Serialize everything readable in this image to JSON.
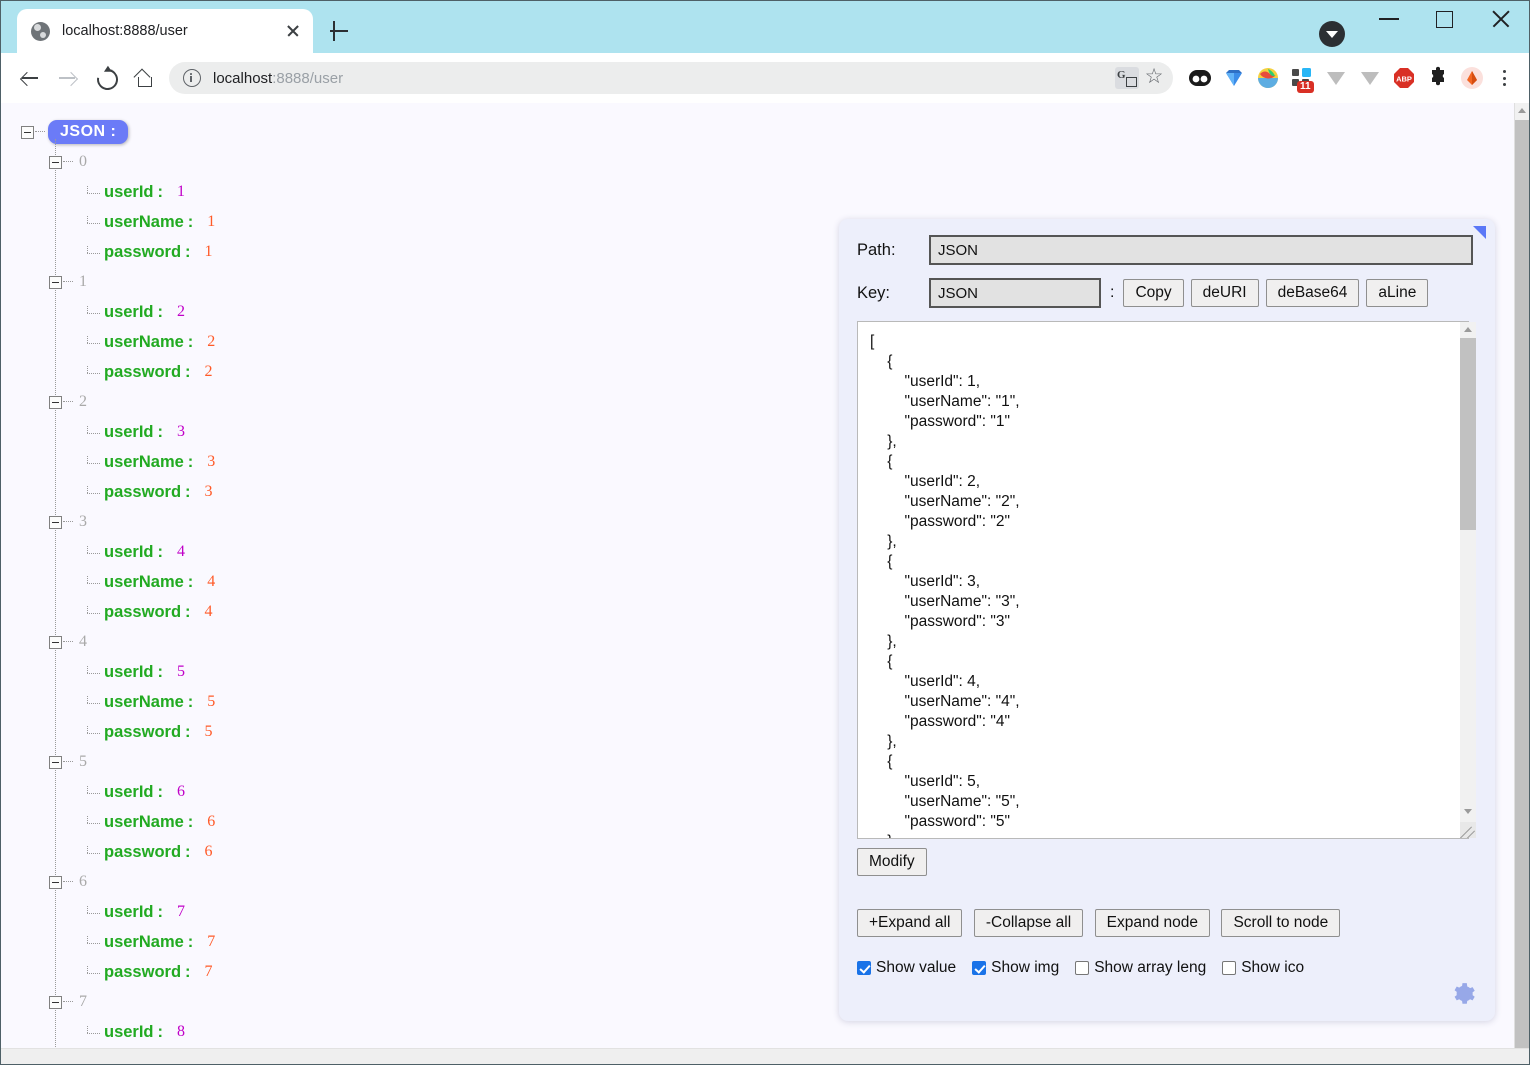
{
  "browser": {
    "tab": {
      "title": "localhost:8888/user",
      "favicon": "globe-icon",
      "close": "close-icon"
    },
    "newtab_label": "+",
    "address": {
      "scheme_host": "localhost",
      "rest": ":8888/user",
      "full": "localhost:8888/user"
    },
    "window_controls": {
      "minimize": "minimize-icon",
      "maximize": "maximize-icon",
      "close": "close-icon"
    },
    "extensions": [
      {
        "name": "ublock-origin-icon"
      },
      {
        "name": "diamond-extension-icon"
      },
      {
        "name": "colorful-bowl-extension-icon"
      },
      {
        "name": "blocks-extension-icon",
        "badge": "11"
      },
      {
        "name": "v-extension-icon"
      },
      {
        "name": "v2-extension-icon"
      },
      {
        "name": "adblock-plus-icon",
        "label": "ABP"
      },
      {
        "name": "puzzle-extensions-icon"
      },
      {
        "name": "profile-avatar-icon"
      }
    ]
  },
  "tree": {
    "root_label": "JSON :",
    "nodes": [
      {
        "index": "0",
        "fields": [
          {
            "key": "userId",
            "value": "1",
            "type": "num"
          },
          {
            "key": "userName",
            "value": "1",
            "type": "str"
          },
          {
            "key": "password",
            "value": "1",
            "type": "str"
          }
        ]
      },
      {
        "index": "1",
        "fields": [
          {
            "key": "userId",
            "value": "2",
            "type": "num"
          },
          {
            "key": "userName",
            "value": "2",
            "type": "str"
          },
          {
            "key": "password",
            "value": "2",
            "type": "str"
          }
        ]
      },
      {
        "index": "2",
        "fields": [
          {
            "key": "userId",
            "value": "3",
            "type": "num"
          },
          {
            "key": "userName",
            "value": "3",
            "type": "str"
          },
          {
            "key": "password",
            "value": "3",
            "type": "str"
          }
        ]
      },
      {
        "index": "3",
        "fields": [
          {
            "key": "userId",
            "value": "4",
            "type": "num"
          },
          {
            "key": "userName",
            "value": "4",
            "type": "str"
          },
          {
            "key": "password",
            "value": "4",
            "type": "str"
          }
        ]
      },
      {
        "index": "4",
        "fields": [
          {
            "key": "userId",
            "value": "5",
            "type": "num"
          },
          {
            "key": "userName",
            "value": "5",
            "type": "str"
          },
          {
            "key": "password",
            "value": "5",
            "type": "str"
          }
        ]
      },
      {
        "index": "5",
        "fields": [
          {
            "key": "userId",
            "value": "6",
            "type": "num"
          },
          {
            "key": "userName",
            "value": "6",
            "type": "str"
          },
          {
            "key": "password",
            "value": "6",
            "type": "str"
          }
        ]
      },
      {
        "index": "6",
        "fields": [
          {
            "key": "userId",
            "value": "7",
            "type": "num"
          },
          {
            "key": "userName",
            "value": "7",
            "type": "str"
          },
          {
            "key": "password",
            "value": "7",
            "type": "str"
          }
        ]
      },
      {
        "index": "7",
        "fields": [
          {
            "key": "userId",
            "value": "8",
            "type": "num"
          }
        ]
      }
    ]
  },
  "panel": {
    "path_label": "Path:",
    "path_value": "JSON",
    "key_label": "Key:",
    "key_value": "JSON",
    "colon": ":",
    "buttons": {
      "copy": "Copy",
      "deuri": "deURI",
      "debase64": "deBase64",
      "aline": "aLine",
      "modify": "Modify",
      "expand_all": "+Expand all",
      "collapse_all": "-Collapse all",
      "expand_node": "Expand node",
      "scroll_to_node": "Scroll to node"
    },
    "json_text": "[\n    {\n        \"userId\": 1,\n        \"userName\": \"1\",\n        \"password\": \"1\"\n    },\n    {\n        \"userId\": 2,\n        \"userName\": \"2\",\n        \"password\": \"2\"\n    },\n    {\n        \"userId\": 3,\n        \"userName\": \"3\",\n        \"password\": \"3\"\n    },\n    {\n        \"userId\": 4,\n        \"userName\": \"4\",\n        \"password\": \"4\"\n    },\n    {\n        \"userId\": 5,\n        \"userName\": \"5\",\n        \"password\": \"5\"\n    }",
    "checkboxes": [
      {
        "label": "Show value",
        "checked": true
      },
      {
        "label": "Show img",
        "checked": true
      },
      {
        "label": "Show array leng",
        "checked": false
      },
      {
        "label": "Show ico",
        "checked": false
      }
    ],
    "gear": "gear-icon",
    "corner": "collapse-corner-icon"
  },
  "colors": {
    "accent_blue": "#6b7bf7",
    "key_green": "#22aa22",
    "num_magenta": "#c000c8",
    "str_orange": "#ff5a28",
    "panel_bg": "#edeffb",
    "page_bg": "#faf9ff",
    "chrome_frame": "#aee3ef",
    "checkbox_blue": "#1a73e8"
  }
}
